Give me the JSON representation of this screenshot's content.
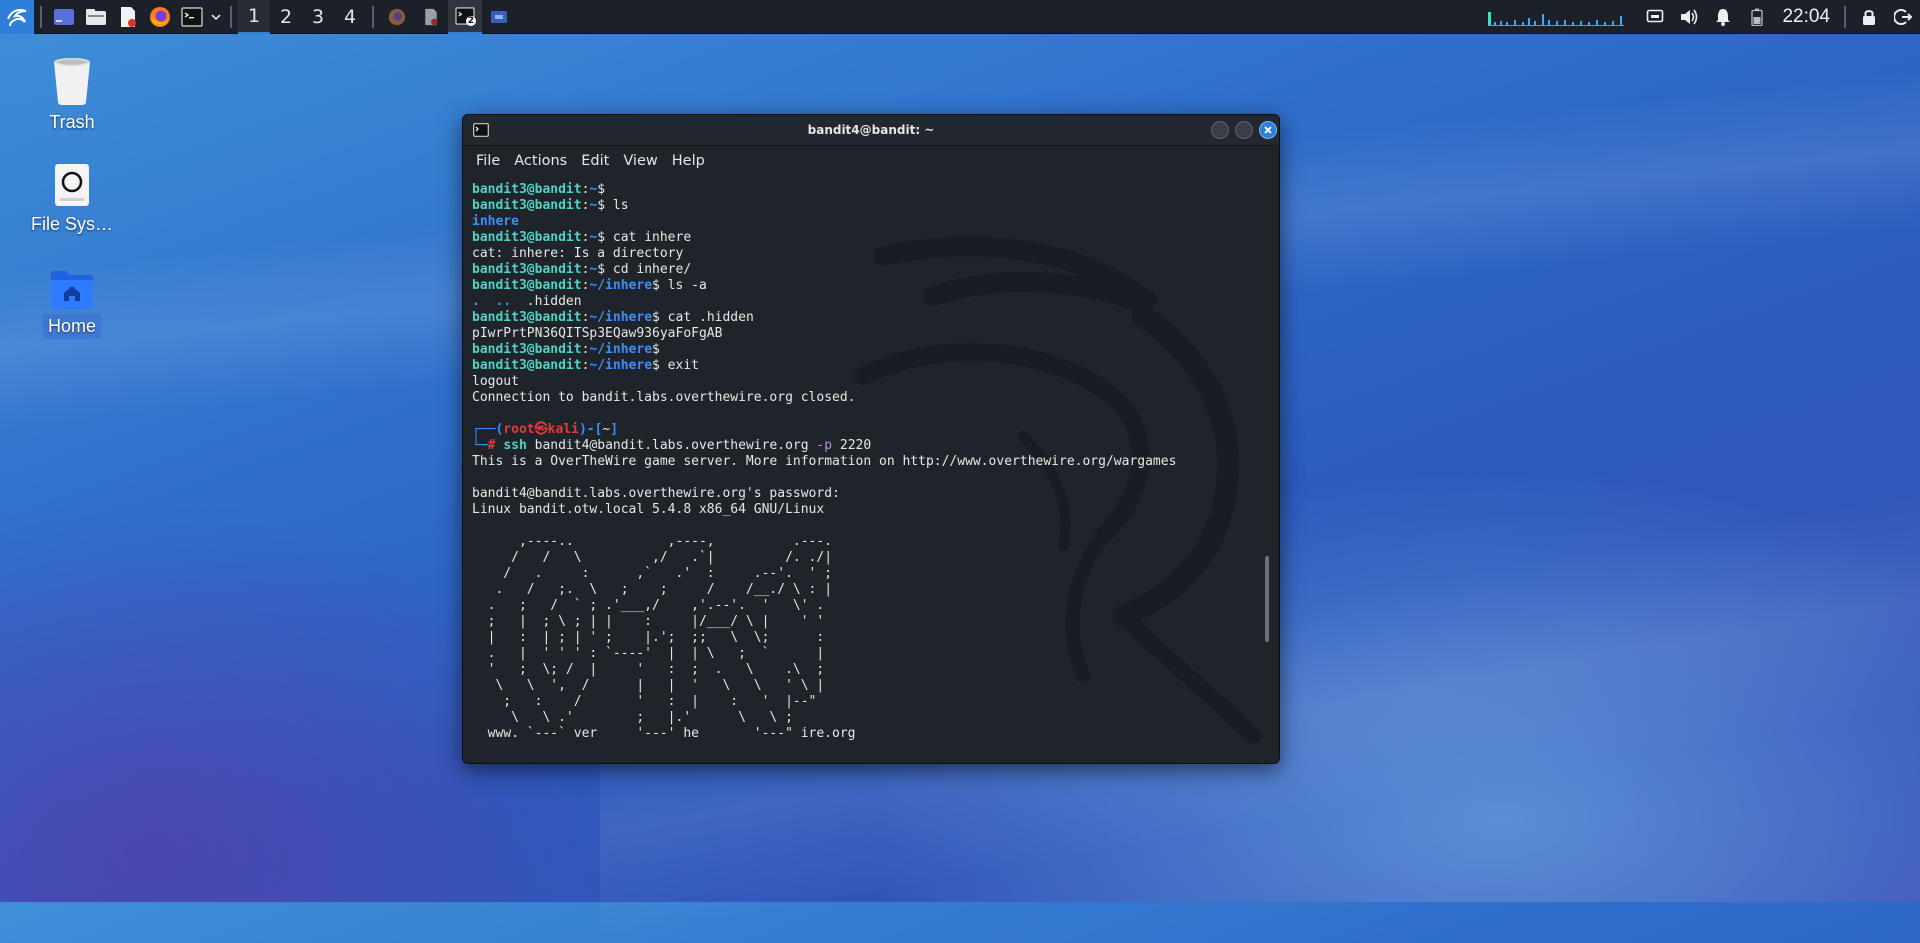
{
  "panel": {
    "workspaces": [
      "1",
      "2",
      "3",
      "4"
    ],
    "active_workspace": 0,
    "clock": "22:04",
    "launchers": [
      "kali-menu-icon",
      "desktop-icon",
      "file-manager-icon",
      "text-editor-icon",
      "firefox-icon",
      "terminal-icon"
    ],
    "tasks": [
      "firefox-task-icon",
      "editor-task-icon",
      "terminal-task-icon",
      "window-task-icon"
    ],
    "terminal_task_badge": "2",
    "tray": [
      "display-icon",
      "volume-icon",
      "notification-bell-icon",
      "battery-icon"
    ],
    "right": [
      "lock-icon",
      "logout-icon"
    ]
  },
  "desktop": {
    "icons": [
      {
        "label": "Trash",
        "icon": "trash-icon"
      },
      {
        "label": "File Sys…",
        "icon": "drive-icon"
      },
      {
        "label": "Home",
        "icon": "home-folder-icon"
      }
    ]
  },
  "window": {
    "title": "bandit4@bandit: ~",
    "menu": [
      "File",
      "Actions",
      "Edit",
      "View",
      "Help"
    ]
  },
  "terminal": {
    "lines": [
      [
        {
          "t": "bandit3@bandit",
          "c": "g"
        },
        {
          "t": ":",
          "c": "w"
        },
        {
          "t": "~",
          "c": "b"
        },
        {
          "t": "$",
          "c": "w"
        }
      ],
      [
        {
          "t": "bandit3@bandit",
          "c": "g"
        },
        {
          "t": ":",
          "c": "w"
        },
        {
          "t": "~",
          "c": "b"
        },
        {
          "t": "$ ls",
          "c": "w"
        }
      ],
      [
        {
          "t": "inhere",
          "c": "b"
        }
      ],
      [
        {
          "t": "bandit3@bandit",
          "c": "g"
        },
        {
          "t": ":",
          "c": "w"
        },
        {
          "t": "~",
          "c": "b"
        },
        {
          "t": "$ cat inhere",
          "c": "w"
        }
      ],
      [
        {
          "t": "cat: inhere: Is a directory",
          "c": "w"
        }
      ],
      [
        {
          "t": "bandit3@bandit",
          "c": "g"
        },
        {
          "t": ":",
          "c": "w"
        },
        {
          "t": "~",
          "c": "b"
        },
        {
          "t": "$ cd inhere/",
          "c": "w"
        }
      ],
      [
        {
          "t": "bandit3@bandit",
          "c": "g"
        },
        {
          "t": ":",
          "c": "w"
        },
        {
          "t": "~/inhere",
          "c": "b"
        },
        {
          "t": "$ ls -a",
          "c": "w"
        }
      ],
      [
        {
          "t": ".  ..",
          "c": "b"
        },
        {
          "t": "  .hidden",
          "c": "w"
        }
      ],
      [
        {
          "t": "bandit3@bandit",
          "c": "g"
        },
        {
          "t": ":",
          "c": "w"
        },
        {
          "t": "~/inhere",
          "c": "b"
        },
        {
          "t": "$ cat .hidden",
          "c": "w"
        }
      ],
      [
        {
          "t": "pIwrPrtPN36QITSp3EQaw936yaFoFgAB",
          "c": "w"
        }
      ],
      [
        {
          "t": "bandit3@bandit",
          "c": "g"
        },
        {
          "t": ":",
          "c": "w"
        },
        {
          "t": "~/inhere",
          "c": "b"
        },
        {
          "t": "$",
          "c": "w"
        }
      ],
      [
        {
          "t": "bandit3@bandit",
          "c": "g"
        },
        {
          "t": ":",
          "c": "w"
        },
        {
          "t": "~/inhere",
          "c": "b"
        },
        {
          "t": "$ exit",
          "c": "w"
        }
      ],
      [
        {
          "t": "logout",
          "c": "w"
        }
      ],
      [
        {
          "t": "Connection to bandit.labs.overthewire.org closed.",
          "c": "w"
        }
      ],
      [
        {
          "t": "",
          "c": "w"
        }
      ],
      [
        {
          "t": "┌──(",
          "c": "b"
        },
        {
          "t": "root㉿kali",
          "c": "r"
        },
        {
          "t": ")-[",
          "c": "b"
        },
        {
          "t": "~",
          "c": "w"
        },
        {
          "t": "]",
          "c": "b"
        }
      ],
      [
        {
          "t": "└─",
          "c": "b"
        },
        {
          "t": "# ",
          "c": "r"
        },
        {
          "t": "ssh ",
          "c": "g"
        },
        {
          "t": "bandit4@bandit.labs.overthewire.org ",
          "c": "w"
        },
        {
          "t": "-p",
          "c": "p"
        },
        {
          "t": " 2220",
          "c": "w"
        }
      ],
      [
        {
          "t": "This is a OverTheWire game server. More information on http://www.overthewire.org/wargames",
          "c": "w"
        }
      ],
      [
        {
          "t": "",
          "c": "w"
        }
      ],
      [
        {
          "t": "bandit4@bandit.labs.overthewire.org's password:",
          "c": "w"
        }
      ],
      [
        {
          "t": "Linux bandit.otw.local 5.4.8 x86_64 GNU/Linux",
          "c": "w"
        }
      ],
      [
        {
          "t": "",
          "c": "w"
        }
      ],
      [
        {
          "t": "      ,----..            ,----,          .---.",
          "c": "w"
        }
      ],
      [
        {
          "t": "     /   /   \\         ,/   .`|         /. ./|",
          "c": "w"
        }
      ],
      [
        {
          "t": "    /   .     :      ,`   .'  :     .--'.  ' ;",
          "c": "w"
        }
      ],
      [
        {
          "t": "   .   /   ;.  \\   ;    ;     /    /__./ \\ : |",
          "c": "w"
        }
      ],
      [
        {
          "t": "  .   ;   /  ` ; .'___,/    ,'.--'.  '   \\' .",
          "c": "w"
        }
      ],
      [
        {
          "t": "  ;   |  ; \\ ; | |    :     |/___/ \\ |    ' '",
          "c": "w"
        }
      ],
      [
        {
          "t": "  |   :  | ; | ' ;    |.';  ;;   \\  \\;      :",
          "c": "w"
        }
      ],
      [
        {
          "t": "  .   |  ' ' ' : `----'  |  | \\   ;  `      |",
          "c": "w"
        }
      ],
      [
        {
          "t": "  '   ;  \\; /  |     '   :  ;  .   \\    .\\  ;",
          "c": "w"
        }
      ],
      [
        {
          "t": "   \\   \\  ',  /      |   |  '   \\   \\   ' \\ |",
          "c": "w"
        }
      ],
      [
        {
          "t": "    ;   :    /       '   :  |    :   '  |--\"",
          "c": "w"
        }
      ],
      [
        {
          "t": "     \\   \\ .'        ;   |.'      \\   \\ ;",
          "c": "w"
        }
      ],
      [
        {
          "t": "  www. `---` ver     '---' he       '---\" ire.org",
          "c": "w"
        }
      ]
    ]
  }
}
